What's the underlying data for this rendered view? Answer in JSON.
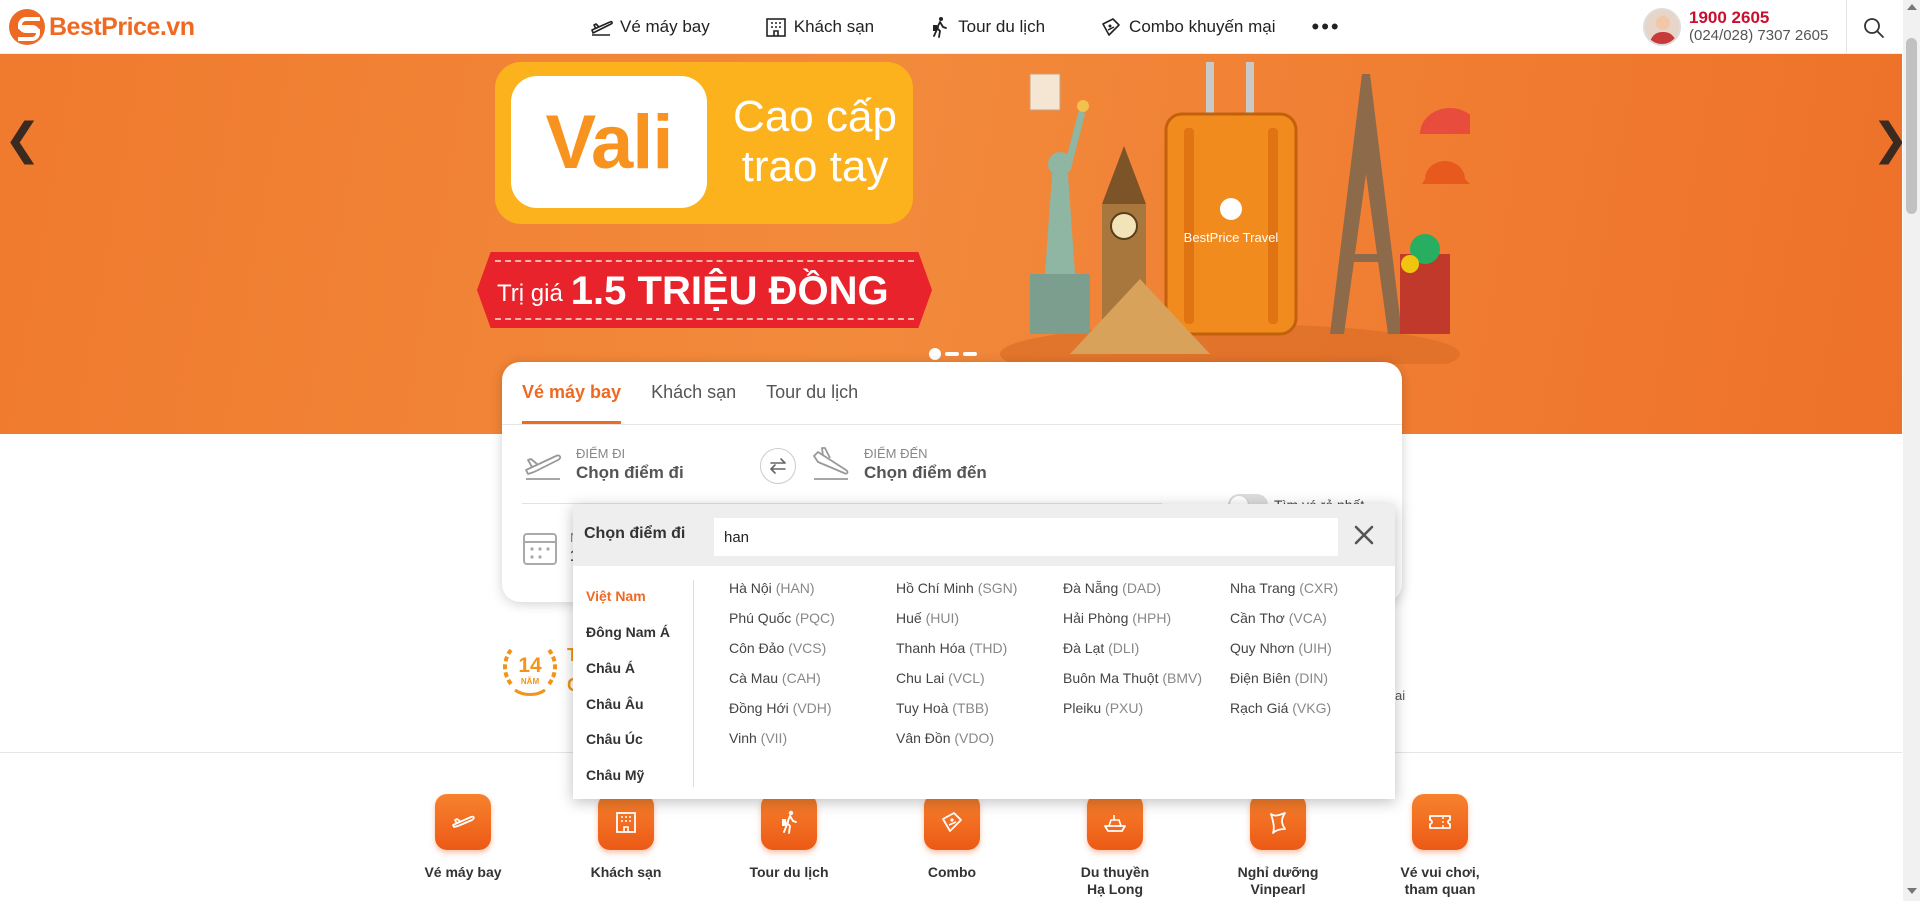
{
  "header": {
    "logo_text": "BestPrice.vn",
    "nav": [
      {
        "label": "Vé máy bay",
        "icon": "plane-icon"
      },
      {
        "label": "Khách sạn",
        "icon": "hotel-icon"
      },
      {
        "label": "Tour du lịch",
        "icon": "walker-icon"
      },
      {
        "label": "Combo khuyến mại",
        "icon": "ticket-icon"
      }
    ],
    "more_label": "•••",
    "phone_main": "1900 2605",
    "phone_sub": "(024/028) 7307 2605"
  },
  "banner": {
    "title_word": "Vali",
    "tagline_1": "Cao cấp",
    "tagline_2": "trao tay",
    "price_prefix": "Trị giá",
    "price_value": "1.5 TRIỆU ĐỒNG",
    "suitcase_brand": "BestPrice Travel",
    "slide_count": 3,
    "active_slide": 1,
    "prev_arrow": "❮",
    "next_arrow": "❯"
  },
  "search_card": {
    "tabs": [
      "Vé máy bay",
      "Khách sạn",
      "Tour du lịch"
    ],
    "active_tab": 0,
    "from_label": "ĐIỂM ĐI",
    "from_value": "Chọn điểm đi",
    "to_label": "ĐIỂM ĐẾN",
    "to_value": "Chọn điểm đến",
    "cheapest_label": "Tìm vé rẻ nhất",
    "date_label_partial": "N",
    "date_value_partial": "1"
  },
  "dropdown": {
    "title": "Chọn điểm đi",
    "input_value": "han",
    "regions": [
      "Việt Nam",
      "Đông Nam Á",
      "Châu Á",
      "Châu Âu",
      "Châu Úc",
      "Châu Mỹ"
    ],
    "active_region": 0,
    "cities": [
      [
        {
          "name": "Hà Nội",
          "code": "(HAN)"
        },
        {
          "name": "Phú Quốc",
          "code": "(PQC)"
        },
        {
          "name": "Côn Đảo",
          "code": "(VCS)"
        },
        {
          "name": "Cà Mau",
          "code": "(CAH)"
        },
        {
          "name": "Đồng Hới",
          "code": "(VDH)"
        },
        {
          "name": "Vinh",
          "code": "(VII)"
        }
      ],
      [
        {
          "name": "Hồ Chí Minh",
          "code": "(SGN)"
        },
        {
          "name": "Huế",
          "code": "(HUI)"
        },
        {
          "name": "Thanh Hóa",
          "code": "(THD)"
        },
        {
          "name": "Chu Lai",
          "code": "(VCL)"
        },
        {
          "name": "Tuy Hoà",
          "code": "(TBB)"
        },
        {
          "name": "Vân Đồn",
          "code": "(VDO)"
        }
      ],
      [
        {
          "name": "Đà Nẵng",
          "code": "(DAD)"
        },
        {
          "name": "Hải Phòng",
          "code": "(HPH)"
        },
        {
          "name": "Đà Lạt",
          "code": "(DLI)"
        },
        {
          "name": "Buôn Ma Thuột",
          "code": "(BMV)"
        },
        {
          "name": "Pleiku",
          "code": "(PXU)"
        }
      ],
      [
        {
          "name": "Nha Trang",
          "code": "(CXR)"
        },
        {
          "name": "Cần Thơ",
          "code": "(VCA)"
        },
        {
          "name": "Quy Nhơn",
          "code": "(UIH)"
        },
        {
          "name": "Điện Biên",
          "code": "(DIN)"
        },
        {
          "name": "Rạch Giá",
          "code": "(VKG)"
        }
      ]
    ]
  },
  "strip": {
    "award_number": "14",
    "award_unit": "NĂM",
    "partial_left_1": "T",
    "partial_left_2": "C",
    "partial_right": "ai"
  },
  "services": [
    {
      "line1": "Vé máy bay",
      "line2": "",
      "icon": "plane-icon"
    },
    {
      "line1": "Khách sạn",
      "line2": "",
      "icon": "hotel-icon"
    },
    {
      "line1": "Tour du lịch",
      "line2": "",
      "icon": "walker-icon"
    },
    {
      "line1": "Combo",
      "line2": "",
      "icon": "ticket-icon"
    },
    {
      "line1": "Du thuyền",
      "line2": "Hạ Long",
      "icon": "cruise-icon"
    },
    {
      "line1": "Nghỉ dưỡng",
      "line2": "Vinpearl",
      "icon": "vinpearl-icon"
    },
    {
      "line1": "Vé vui chơi,",
      "line2": "tham quan",
      "icon": "entry-ticket-icon"
    }
  ],
  "colors": {
    "brand_orange": "#ee6a23",
    "phone_red": "#c8102e",
    "banner_orange": "#f07a2e",
    "badge_yellow": "#fbb21c",
    "ribbon_red": "#e8232b"
  }
}
